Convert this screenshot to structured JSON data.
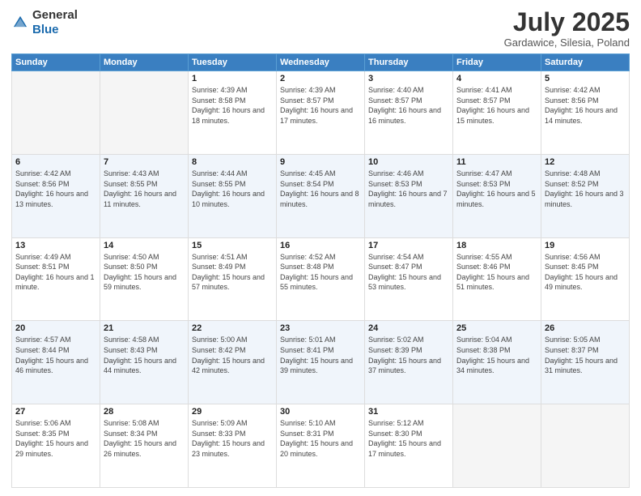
{
  "header": {
    "logo_general": "General",
    "logo_blue": "Blue",
    "title": "July 2025",
    "location": "Gardawice, Silesia, Poland"
  },
  "weekdays": [
    "Sunday",
    "Monday",
    "Tuesday",
    "Wednesday",
    "Thursday",
    "Friday",
    "Saturday"
  ],
  "weeks": [
    [
      {
        "day": "",
        "info": ""
      },
      {
        "day": "",
        "info": ""
      },
      {
        "day": "1",
        "info": "Sunrise: 4:39 AM\nSunset: 8:58 PM\nDaylight: 16 hours and 18 minutes."
      },
      {
        "day": "2",
        "info": "Sunrise: 4:39 AM\nSunset: 8:57 PM\nDaylight: 16 hours and 17 minutes."
      },
      {
        "day": "3",
        "info": "Sunrise: 4:40 AM\nSunset: 8:57 PM\nDaylight: 16 hours and 16 minutes."
      },
      {
        "day": "4",
        "info": "Sunrise: 4:41 AM\nSunset: 8:57 PM\nDaylight: 16 hours and 15 minutes."
      },
      {
        "day": "5",
        "info": "Sunrise: 4:42 AM\nSunset: 8:56 PM\nDaylight: 16 hours and 14 minutes."
      }
    ],
    [
      {
        "day": "6",
        "info": "Sunrise: 4:42 AM\nSunset: 8:56 PM\nDaylight: 16 hours and 13 minutes."
      },
      {
        "day": "7",
        "info": "Sunrise: 4:43 AM\nSunset: 8:55 PM\nDaylight: 16 hours and 11 minutes."
      },
      {
        "day": "8",
        "info": "Sunrise: 4:44 AM\nSunset: 8:55 PM\nDaylight: 16 hours and 10 minutes."
      },
      {
        "day": "9",
        "info": "Sunrise: 4:45 AM\nSunset: 8:54 PM\nDaylight: 16 hours and 8 minutes."
      },
      {
        "day": "10",
        "info": "Sunrise: 4:46 AM\nSunset: 8:53 PM\nDaylight: 16 hours and 7 minutes."
      },
      {
        "day": "11",
        "info": "Sunrise: 4:47 AM\nSunset: 8:53 PM\nDaylight: 16 hours and 5 minutes."
      },
      {
        "day": "12",
        "info": "Sunrise: 4:48 AM\nSunset: 8:52 PM\nDaylight: 16 hours and 3 minutes."
      }
    ],
    [
      {
        "day": "13",
        "info": "Sunrise: 4:49 AM\nSunset: 8:51 PM\nDaylight: 16 hours and 1 minute."
      },
      {
        "day": "14",
        "info": "Sunrise: 4:50 AM\nSunset: 8:50 PM\nDaylight: 15 hours and 59 minutes."
      },
      {
        "day": "15",
        "info": "Sunrise: 4:51 AM\nSunset: 8:49 PM\nDaylight: 15 hours and 57 minutes."
      },
      {
        "day": "16",
        "info": "Sunrise: 4:52 AM\nSunset: 8:48 PM\nDaylight: 15 hours and 55 minutes."
      },
      {
        "day": "17",
        "info": "Sunrise: 4:54 AM\nSunset: 8:47 PM\nDaylight: 15 hours and 53 minutes."
      },
      {
        "day": "18",
        "info": "Sunrise: 4:55 AM\nSunset: 8:46 PM\nDaylight: 15 hours and 51 minutes."
      },
      {
        "day": "19",
        "info": "Sunrise: 4:56 AM\nSunset: 8:45 PM\nDaylight: 15 hours and 49 minutes."
      }
    ],
    [
      {
        "day": "20",
        "info": "Sunrise: 4:57 AM\nSunset: 8:44 PM\nDaylight: 15 hours and 46 minutes."
      },
      {
        "day": "21",
        "info": "Sunrise: 4:58 AM\nSunset: 8:43 PM\nDaylight: 15 hours and 44 minutes."
      },
      {
        "day": "22",
        "info": "Sunrise: 5:00 AM\nSunset: 8:42 PM\nDaylight: 15 hours and 42 minutes."
      },
      {
        "day": "23",
        "info": "Sunrise: 5:01 AM\nSunset: 8:41 PM\nDaylight: 15 hours and 39 minutes."
      },
      {
        "day": "24",
        "info": "Sunrise: 5:02 AM\nSunset: 8:39 PM\nDaylight: 15 hours and 37 minutes."
      },
      {
        "day": "25",
        "info": "Sunrise: 5:04 AM\nSunset: 8:38 PM\nDaylight: 15 hours and 34 minutes."
      },
      {
        "day": "26",
        "info": "Sunrise: 5:05 AM\nSunset: 8:37 PM\nDaylight: 15 hours and 31 minutes."
      }
    ],
    [
      {
        "day": "27",
        "info": "Sunrise: 5:06 AM\nSunset: 8:35 PM\nDaylight: 15 hours and 29 minutes."
      },
      {
        "day": "28",
        "info": "Sunrise: 5:08 AM\nSunset: 8:34 PM\nDaylight: 15 hours and 26 minutes."
      },
      {
        "day": "29",
        "info": "Sunrise: 5:09 AM\nSunset: 8:33 PM\nDaylight: 15 hours and 23 minutes."
      },
      {
        "day": "30",
        "info": "Sunrise: 5:10 AM\nSunset: 8:31 PM\nDaylight: 15 hours and 20 minutes."
      },
      {
        "day": "31",
        "info": "Sunrise: 5:12 AM\nSunset: 8:30 PM\nDaylight: 15 hours and 17 minutes."
      },
      {
        "day": "",
        "info": ""
      },
      {
        "day": "",
        "info": ""
      }
    ]
  ]
}
